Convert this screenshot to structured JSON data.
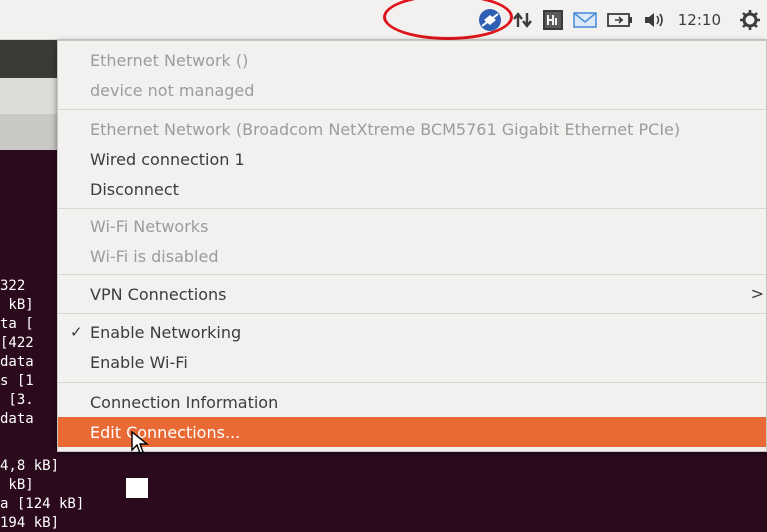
{
  "panel": {
    "clock": "12:10",
    "icons": [
      "dropbox-icon",
      "network-updown-icon",
      "hardinfo-icon",
      "mail-icon",
      "battery-icon",
      "volume-icon",
      "session-gear-icon"
    ]
  },
  "menu": {
    "items": [
      {
        "label": "Ethernet Network ()",
        "state": "disabled"
      },
      {
        "label": "device not managed",
        "state": "disabled"
      },
      {
        "label": "Ethernet Network (Broadcom NetXtreme BCM5761 Gigabit Ethernet PCIe)",
        "state": "disabled"
      },
      {
        "label": "Wired connection 1",
        "state": "normal"
      },
      {
        "label": "Disconnect",
        "state": "normal"
      },
      {
        "label": "Wi-Fi Networks",
        "state": "disabled"
      },
      {
        "label": "Wi-Fi is disabled",
        "state": "disabled"
      },
      {
        "label": "VPN Connections",
        "state": "normal",
        "submenu": ">"
      },
      {
        "label": "Enable Networking",
        "state": "checked",
        "check": "✓"
      },
      {
        "label": "Enable Wi-Fi",
        "state": "normal"
      },
      {
        "label": "Connection Information",
        "state": "normal"
      },
      {
        "label": "Edit Connections...",
        "state": "highlighted"
      }
    ]
  },
  "terminal": {
    "lines": [
      "322",
      " kB]",
      "ta [",
      "[422",
      "data",
      "s [1",
      " [3.",
      "data",
      "4,8 kB]",
      " kB]",
      "a [124 kB]",
      "194 kB]"
    ]
  },
  "colors": {
    "highlight": "#e96a35",
    "annotation_ring": "#e0141a",
    "terminal_bg": "#2c0a1e",
    "panel_bg": "#f2f1f0"
  }
}
